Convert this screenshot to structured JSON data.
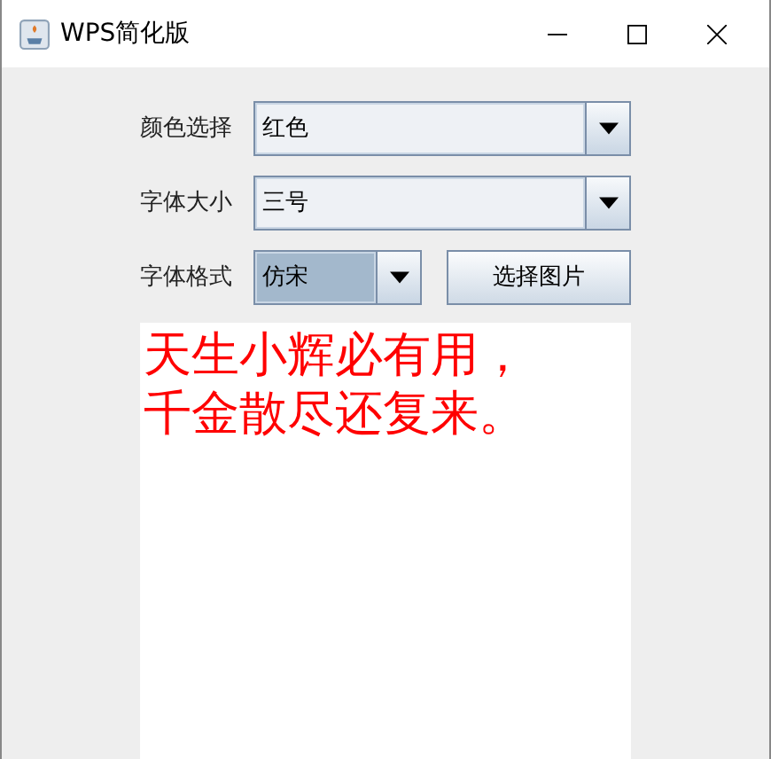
{
  "window": {
    "title": "WPS简化版"
  },
  "combos": [
    {
      "label": "颜色选择",
      "value": "红色",
      "focused": false
    },
    {
      "label": "字体大小",
      "value": "三号",
      "focused": false
    },
    {
      "label": "字体格式",
      "value": "仿宋",
      "focused": true
    }
  ],
  "button": "选择图片",
  "text_area": {
    "color": "#ff0000",
    "lines": [
      "天生小辉必有用，",
      "千金散尽还复来。"
    ]
  }
}
